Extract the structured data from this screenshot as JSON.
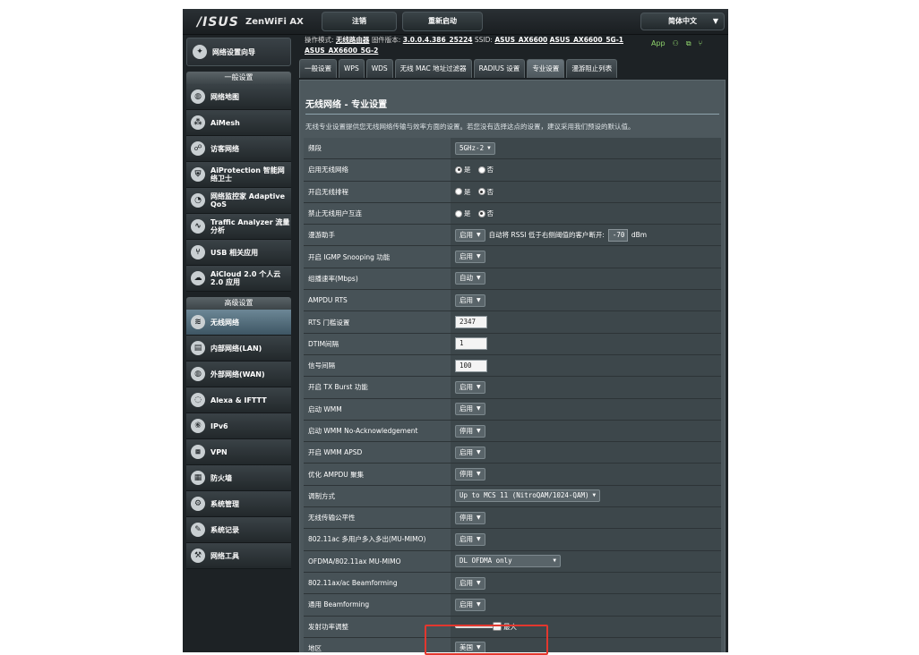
{
  "header": {
    "brand": "/ISUS",
    "model": "ZenWiFi AX",
    "logout_label": "注销",
    "reboot_label": "重新启动",
    "language": "简体中文"
  },
  "sidebar": {
    "wizard": "网络设置向导",
    "general_header": "一般设置",
    "general_items": [
      {
        "label": "网络地图",
        "icon": "globe-icon"
      },
      {
        "label": "AiMesh",
        "icon": "mesh-icon"
      },
      {
        "label": "访客网络",
        "icon": "guest-network-icon"
      },
      {
        "label": "AiProtection 智能网络卫士",
        "icon": "shield-lock-icon"
      },
      {
        "label": "网络监控家 Adaptive QoS",
        "icon": "gauge-icon"
      },
      {
        "label": "Traffic Analyzer 流量分析",
        "icon": "analyzer-icon"
      },
      {
        "label": "USB 相关应用",
        "icon": "usb-icon"
      },
      {
        "label": "AiCloud 2.0 个人云 2.0 应用",
        "icon": "cloud-icon"
      }
    ],
    "advanced_header": "高级设置",
    "advanced_items": [
      {
        "label": "无线网络",
        "icon": "wifi-icon",
        "active": true
      },
      {
        "label": "内部网络(LAN)",
        "icon": "lan-icon"
      },
      {
        "label": "外部网络(WAN)",
        "icon": "wan-globe-icon"
      },
      {
        "label": "Alexa & IFTTT",
        "icon": "alexa-icon"
      },
      {
        "label": "IPv6",
        "icon": "ipv6-icon"
      },
      {
        "label": "VPN",
        "icon": "vpn-icon"
      },
      {
        "label": "防火墙",
        "icon": "firewall-icon"
      },
      {
        "label": "系统管理",
        "icon": "admin-icon"
      },
      {
        "label": "系统记录",
        "icon": "log-icon"
      },
      {
        "label": "网络工具",
        "icon": "tools-icon"
      }
    ]
  },
  "infobar": {
    "mode_label": "操作模式:",
    "mode_value": "无线路由器",
    "fw_label": "固件版本:",
    "fw_value": "3.0.0.4.386_25224",
    "ssid_label": "SSID:",
    "ssid1": "ASUS_AX6600",
    "ssid2": "ASUS_AX6600_5G-1",
    "ssid3": "ASUS_AX6600_5G-2",
    "app_label": "App"
  },
  "tabs": [
    "一般设置",
    "WPS",
    "WDS",
    "无线 MAC 地址过滤器",
    "RADIUS 设置",
    "专业设置",
    "漫游阻止列表"
  ],
  "active_tab": 5,
  "page": {
    "title": "无线网络 - 专业设置",
    "description": "无线专业设置提供您无线网络传输与效率方面的设置。若您没有选择这点的设置，建议采用我们预设的默认值。"
  },
  "settings": [
    {
      "label": "频段",
      "type": "select",
      "value": "5GHz-2"
    },
    {
      "label": "启用无线网络",
      "type": "radio",
      "options": [
        "是",
        "否"
      ],
      "selected": 0
    },
    {
      "label": "开启无线排程",
      "type": "radio",
      "options": [
        "是",
        "否"
      ],
      "selected": 1
    },
    {
      "label": "禁止无线用户互连",
      "type": "radio",
      "options": [
        "是",
        "否"
      ],
      "selected": 1
    },
    {
      "label": "漫游助手",
      "type": "roaming",
      "value": "启用",
      "text": "自动将 RSSI 低于右侧阈值的客户断开:",
      "rssi": "-70",
      "unit": "dBm"
    },
    {
      "label": "开启 IGMP Snooping 功能",
      "type": "select",
      "value": "启用"
    },
    {
      "label": "组播速率(Mbps)",
      "type": "select",
      "value": "自动"
    },
    {
      "label": "AMPDU RTS",
      "type": "select",
      "value": "启用"
    },
    {
      "label": "RTS 门槛设置",
      "type": "text",
      "value": "2347"
    },
    {
      "label": "DTIM间隔",
      "type": "text",
      "value": "1"
    },
    {
      "label": "信号间隔",
      "type": "text",
      "value": "100"
    },
    {
      "label": "开启 TX Burst 功能",
      "type": "select",
      "value": "启用"
    },
    {
      "label": "启动 WMM",
      "type": "select",
      "value": "启用"
    },
    {
      "label": "启动 WMM No-Acknowledgement",
      "type": "select",
      "value": "停用"
    },
    {
      "label": "开启 WMM APSD",
      "type": "select",
      "value": "启用"
    },
    {
      "label": "优化 AMPDU 聚集",
      "type": "select",
      "value": "停用"
    },
    {
      "label": "调制方式",
      "type": "select",
      "value": "Up to MCS 11 (NitroQAM/1024-QAM)"
    },
    {
      "label": "无线传输公平性",
      "type": "select",
      "value": "停用"
    },
    {
      "label": "802.11ac 多用户多入多出(MU-MIMO)",
      "type": "select",
      "value": "启用"
    },
    {
      "label": "OFDMA/802.11ax MU-MIMO",
      "type": "select",
      "value": "DL OFDMA only"
    },
    {
      "label": "802.11ax/ac Beamforming",
      "type": "select",
      "value": "启用"
    },
    {
      "label": "通用 Beamforming",
      "type": "select",
      "value": "启用"
    },
    {
      "label": "发射功率调整",
      "type": "slider",
      "value": "最大",
      "level": 1.0
    },
    {
      "label": "地区",
      "type": "select",
      "value": "美国"
    }
  ],
  "colors": {
    "active_nav": "#5a7686",
    "highlight_box": "#e3372e",
    "background": "#1d2225"
  }
}
